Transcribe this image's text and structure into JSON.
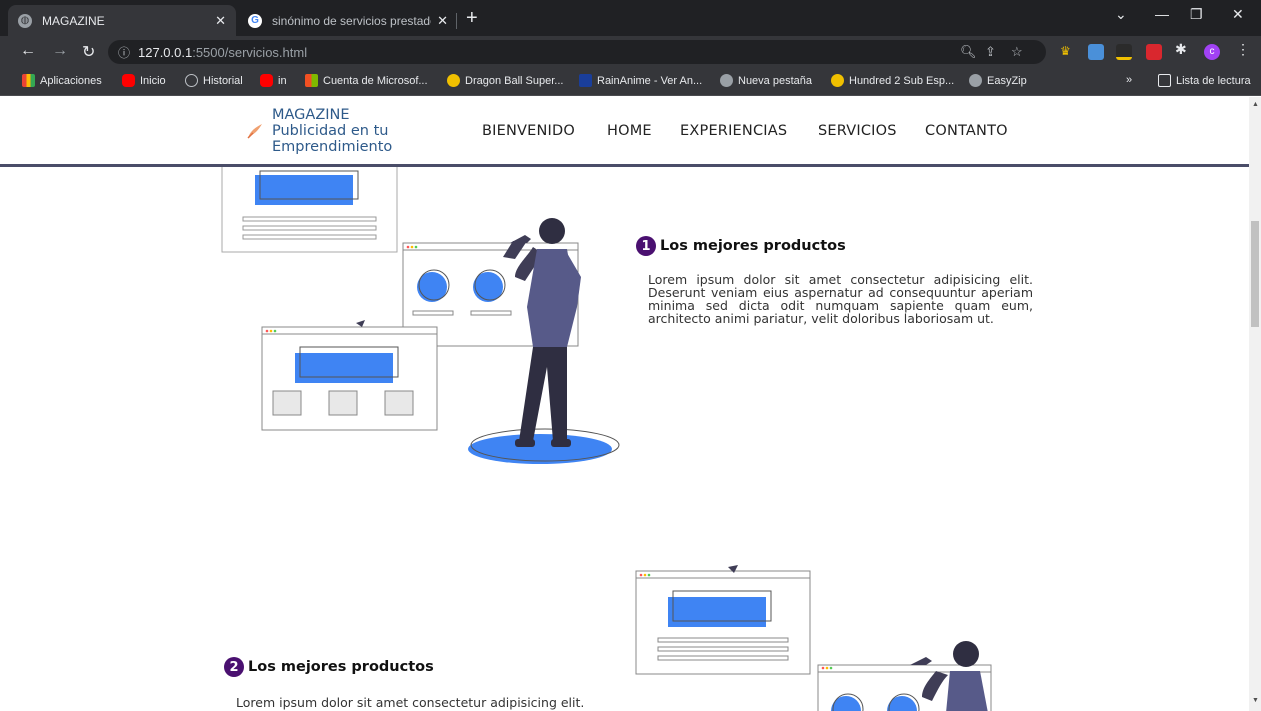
{
  "browser": {
    "tabs": [
      {
        "title": "MAGAZINE",
        "active": true
      },
      {
        "title": "sinónimo de servicios prestados",
        "active": false
      }
    ],
    "url": {
      "host": "127.0.0.1",
      "rest": ":5500/servicios.html"
    },
    "bookmarks": [
      {
        "label": "Aplicaciones",
        "color": "#f4b400"
      },
      {
        "label": "Inicio",
        "color": "#ff0000"
      },
      {
        "label": "Historial",
        "color": "#9aa0a6"
      },
      {
        "label": "in",
        "color": "#ff0000"
      },
      {
        "label": "Cuenta de Microsof...",
        "color": "#f25022"
      },
      {
        "label": "Dragon Ball Super...",
        "color": "#f0c000"
      },
      {
        "label": "RainAnime - Ver An...",
        "color": "#1a3e9a"
      },
      {
        "label": "Nueva pestaña",
        "color": "#9aa0a6"
      },
      {
        "label": "Hundred 2 Sub Esp...",
        "color": "#f0c000"
      },
      {
        "label": "EasyZip",
        "color": "#9aa0a6"
      }
    ],
    "reading_list": "Lista de lectura",
    "profile_initial": "c"
  },
  "site": {
    "logo_lines": [
      "MAGAZINE",
      "Publicidad en tu",
      "Emprendimiento"
    ],
    "nav": [
      "BIENVENIDO",
      "HOME",
      "EXPERIENCIAS",
      "SERVICIOS",
      "CONTANTO"
    ]
  },
  "features": [
    {
      "number": "1",
      "title": "Los mejores productos",
      "text": "Lorem ipsum dolor sit amet consectetur adipisicing elit. Deserunt veniam eius aspernatur ad consequuntur aperiam minima sed dicta odit numquam sapiente quam eum, architecto animi pariatur, velit doloribus laboriosam ut."
    },
    {
      "number": "2",
      "title": "Los mejores productos",
      "text": "Lorem ipsum dolor sit amet consectetur adipisicing elit."
    }
  ],
  "colors": {
    "accent_blue": "#3f84f3",
    "number_badge": "#4a1070",
    "person": "#3f3d56",
    "header_border": "#4a4d68"
  }
}
